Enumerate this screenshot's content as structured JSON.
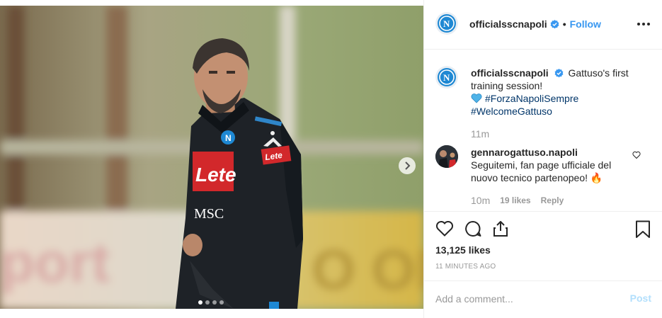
{
  "post": {
    "account": {
      "username": "officialsscnapoli",
      "verified": true,
      "follow_label": "Follow",
      "separator": "•"
    },
    "caption": {
      "text": "Gattuso's first training session!",
      "hashtag_1": "#ForzaNapoliSempre",
      "hashtag_2": "#WelcomeGattuso",
      "time": "11m"
    },
    "comment": {
      "username": "gennarogattuso.napoli",
      "text": "Seguitemi, fan page ufficiale del nuovo tecnico partenopeo! 🔥",
      "time": "10m",
      "likes": "19 likes",
      "reply_label": "Reply"
    },
    "stats": {
      "likes": "13,125 likes",
      "posted_ago": "11 MINUTES AGO"
    },
    "add_comment": {
      "placeholder": "Add a comment...",
      "post_label": "Post"
    },
    "photo": {
      "jersey_sponsor": "Lete",
      "jersey_brand": "MSC",
      "sleeve_sponsor": "Lete",
      "carousel_count": 4,
      "carousel_active": 1
    }
  },
  "colors": {
    "link_blue": "#3897f0",
    "hashtag": "#003569",
    "napoli_blue": "#1e88d3",
    "muted": "#999999",
    "post_disabled": "#b2dffc"
  },
  "icons": {
    "verified": "verified-badge-icon",
    "more": "more-options-icon",
    "heart": "heart-icon",
    "comment": "comment-icon",
    "share": "share-icon",
    "bookmark": "bookmark-icon",
    "next": "chevron-right-icon"
  }
}
